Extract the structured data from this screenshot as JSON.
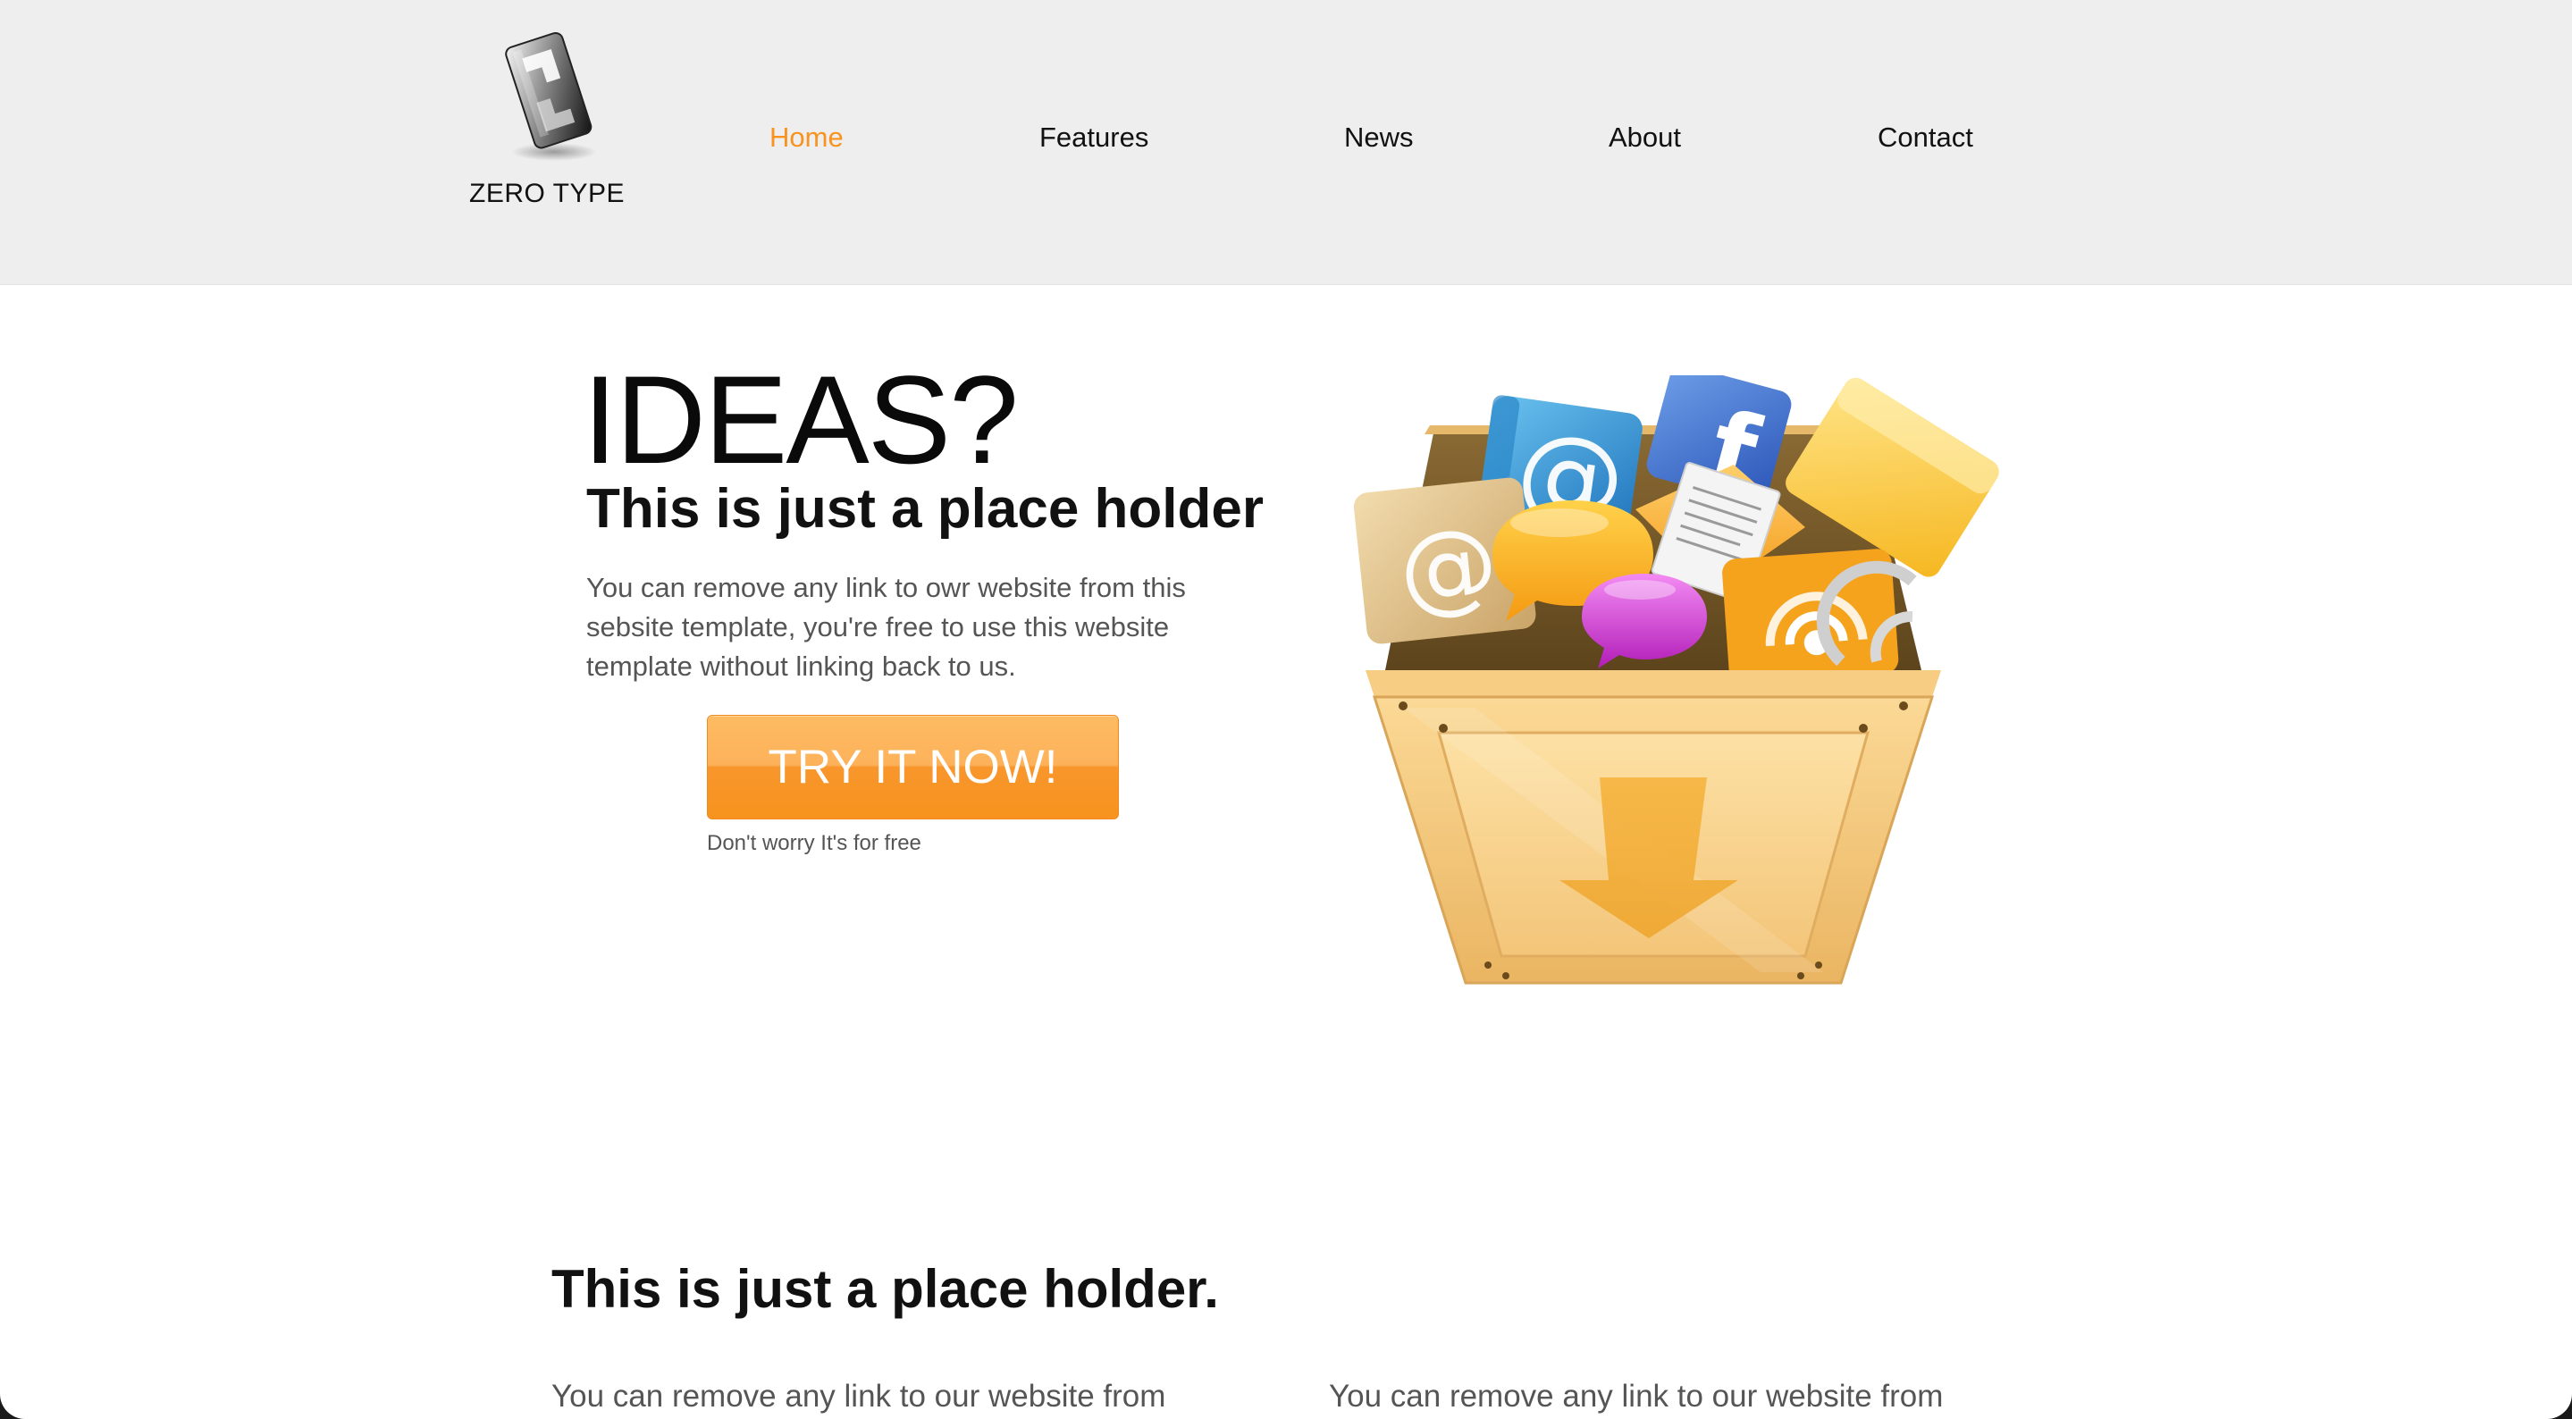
{
  "header": {
    "logo_text": "ZERO TYPE",
    "nav": [
      {
        "label": "Home",
        "active": true
      },
      {
        "label": "Features",
        "active": false
      },
      {
        "label": "News",
        "active": false
      },
      {
        "label": "About",
        "active": false
      },
      {
        "label": "Contact",
        "active": false
      }
    ]
  },
  "hero": {
    "title": "IDEAS?",
    "subtitle": "This is just a place holder",
    "text": "You can remove any link to owr website from this sebsite template, you're free to use this website template without linking back to us.",
    "cta_label": "TRY IT NOW!",
    "cta_note": "Don't worry It's for free"
  },
  "section": {
    "title": "This is just a place holder.",
    "col_left": "You can remove any link to our website from",
    "col_right": "You can remove any link to our website from"
  },
  "colors": {
    "accent": "#f7931e",
    "header_bg": "#eeeeee",
    "text_dark": "#111111",
    "text_muted": "#555555"
  },
  "icons": {
    "logo": "zero-type-logo-icon",
    "hero_art": "download-crate-icon"
  }
}
